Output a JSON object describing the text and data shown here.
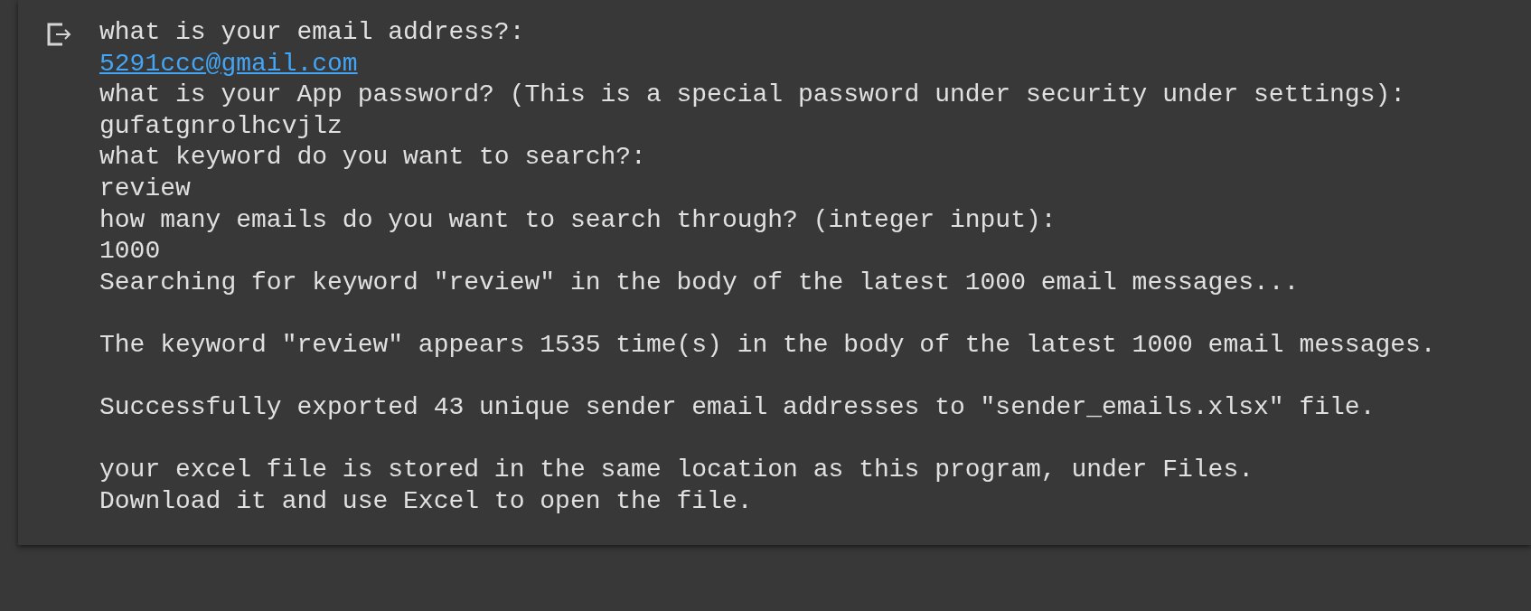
{
  "output_lines": [
    {
      "kind": "text",
      "text": "what is your email address?:"
    },
    {
      "kind": "link",
      "text": "5291ccc@gmail.com"
    },
    {
      "kind": "text",
      "text": "what is your App password? (This is a special password under security under settings):"
    },
    {
      "kind": "text",
      "text": "gufatgnrolhcvjlz"
    },
    {
      "kind": "text",
      "text": "what keyword do you want to search?:"
    },
    {
      "kind": "text",
      "text": "review"
    },
    {
      "kind": "text",
      "text": "how many emails do you want to search through? (integer input):"
    },
    {
      "kind": "text",
      "text": "1000"
    },
    {
      "kind": "text",
      "text": "Searching for keyword \"review\" in the body of the latest 1000 email messages..."
    },
    {
      "kind": "blank"
    },
    {
      "kind": "text",
      "text": "The keyword \"review\" appears 1535 time(s) in the body of the latest 1000 email messages."
    },
    {
      "kind": "blank"
    },
    {
      "kind": "text",
      "text": "Successfully exported 43 unique sender email addresses to \"sender_emails.xlsx\" file."
    },
    {
      "kind": "blank"
    },
    {
      "kind": "text",
      "text": "your excel file is stored in the same location as this program, under Files."
    },
    {
      "kind": "text",
      "text": "Download it and use Excel to open the file."
    }
  ]
}
